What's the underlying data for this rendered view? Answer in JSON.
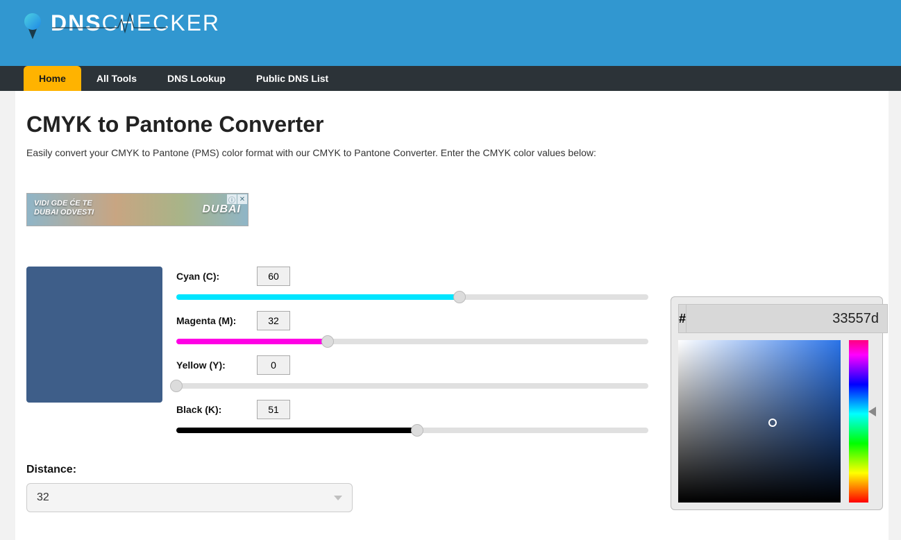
{
  "logo": {
    "text_dns": "DNS",
    "text_checker": "CHECKER"
  },
  "nav": {
    "items": [
      {
        "label": "Home",
        "active": true
      },
      {
        "label": "All Tools",
        "active": false
      },
      {
        "label": "DNS Lookup",
        "active": false
      },
      {
        "label": "Public DNS List",
        "active": false
      }
    ]
  },
  "page": {
    "title": "CMYK to Pantone Converter",
    "description": "Easily convert your CMYK to Pantone (PMS) color format with our CMYK to Pantone Converter. Enter the CMYK color values below:"
  },
  "ad": {
    "line1": "VIDI GDE ĆE TE",
    "line2": "DUBAI ODVESTI",
    "brand": "DUBAI"
  },
  "swatch_color": "#3e5e89",
  "sliders": {
    "cyan": {
      "label": "Cyan (C):",
      "value": "60",
      "percent": 60
    },
    "magenta": {
      "label": "Magenta (M):",
      "value": "32",
      "percent": 32
    },
    "yellow": {
      "label": "Yellow (Y):",
      "value": "0",
      "percent": 0
    },
    "black": {
      "label": "Black (K):",
      "value": "51",
      "percent": 51
    }
  },
  "distance": {
    "label": "Distance:",
    "value": "32"
  },
  "picker": {
    "hash": "#",
    "hex": "33557d",
    "selector": {
      "x_pct": 58,
      "y_pct": 51
    },
    "hue_pct": 44,
    "area_hue_color": "#2a73e8"
  }
}
